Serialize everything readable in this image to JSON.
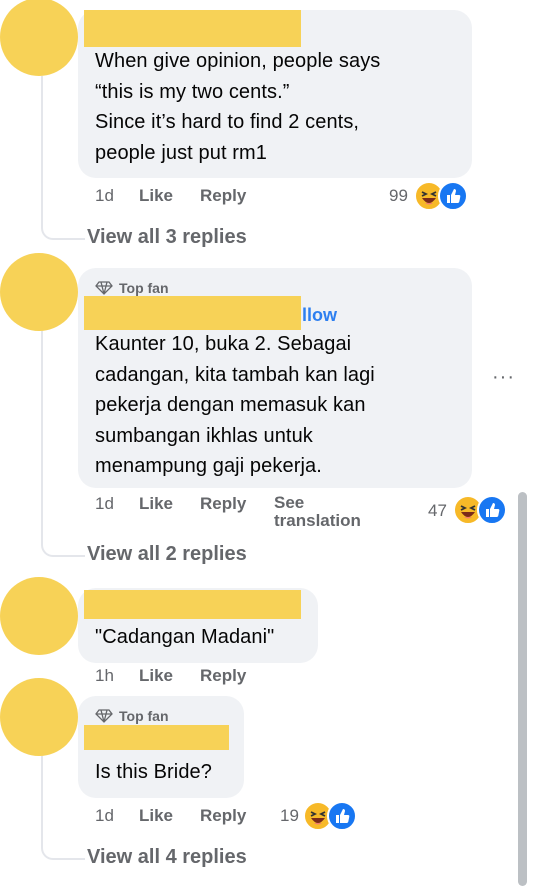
{
  "comments": [
    {
      "lines": [
        "When give opinion, people says",
        "“this is my two cents.”",
        "Since it’s hard to find 2 cents,",
        "people just put rm1"
      ],
      "time": "1d",
      "like": "Like",
      "reply": "Reply",
      "reaction_count": "99",
      "view_replies": "View all 3 replies"
    },
    {
      "badge": "Top fan",
      "name_fragment": "llow",
      "lines": [
        "Kaunter 10, buka 2. Sebagai",
        "cadangan, kita tambah kan lagi",
        "pekerja dengan memasuk kan",
        "sumbangan ikhlas untuk",
        "menampung gaji pekerja."
      ],
      "time": "1d",
      "like": "Like",
      "reply": "Reply",
      "see_translation": [
        "See",
        "translation"
      ],
      "reaction_count": "47",
      "view_replies": "View all 2 replies",
      "more": "···"
    },
    {
      "lines": [
        "\"Cadangan Madani\""
      ],
      "time": "1h",
      "like": "Like",
      "reply": "Reply"
    },
    {
      "badge": "Top fan",
      "lines": [
        "Is this Bride?"
      ],
      "time": "1d",
      "like": "Like",
      "reply": "Reply",
      "reaction_count": "19",
      "view_replies": "View all 4 replies"
    }
  ],
  "colors": {
    "avatar": "#f7d257",
    "bubble": "#f0f2f5",
    "link": "#2d7ff0",
    "like_blue": "#1877f2",
    "haha_yellow": "#f7b928"
  },
  "icons": [
    "haha-reaction-icon",
    "like-reaction-icon",
    "diamond-icon",
    "more-options-icon"
  ]
}
